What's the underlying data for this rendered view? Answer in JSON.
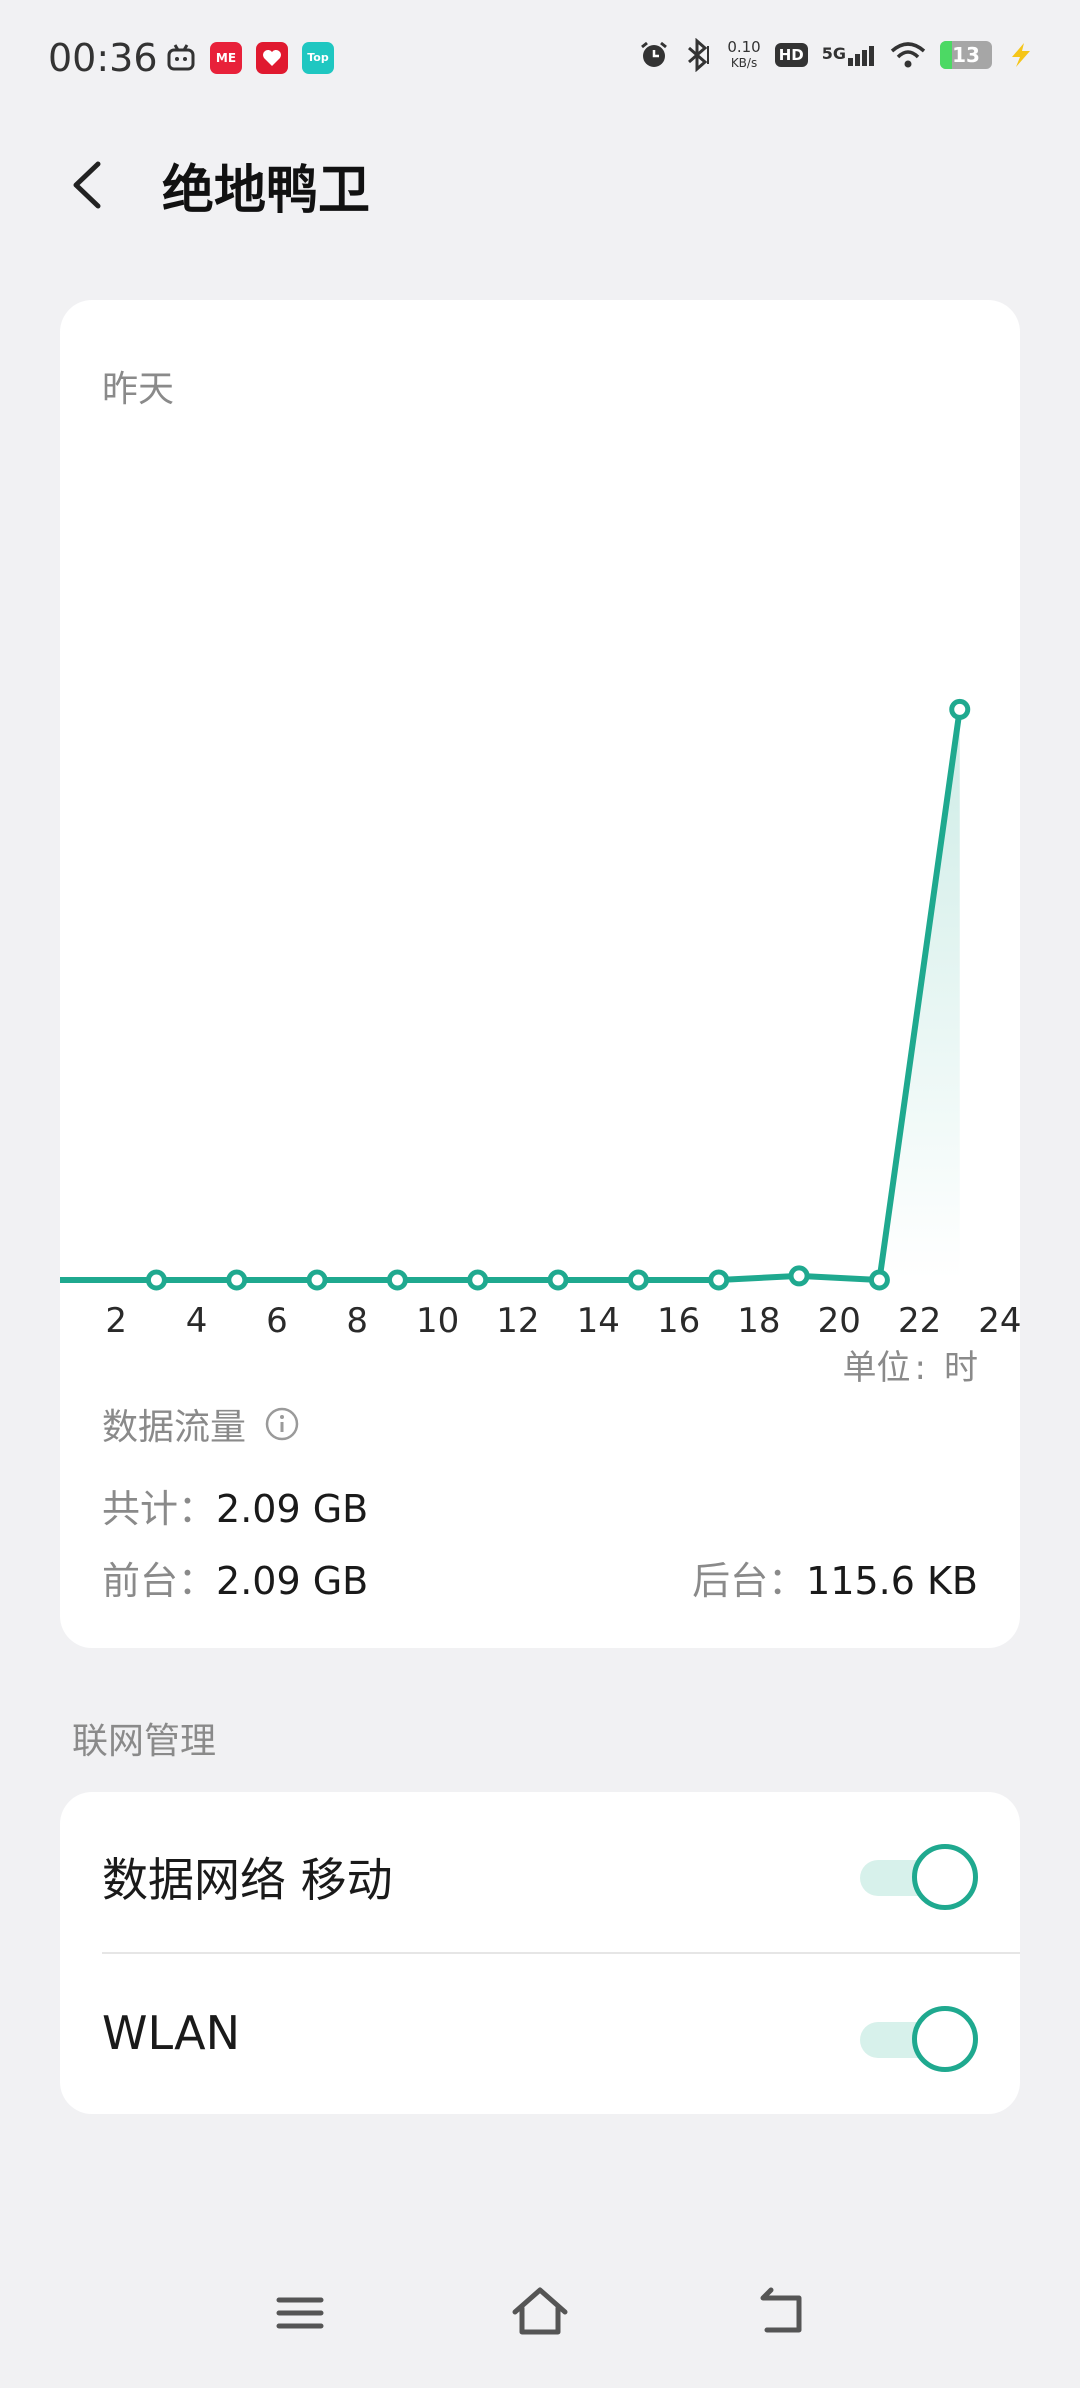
{
  "status": {
    "time": "00:36",
    "net_speed_value": "0.10",
    "net_speed_unit": "KB/s",
    "hd_label": "HD",
    "network_type": "5G",
    "battery": "13",
    "app_badges": [
      {
        "label": "ME",
        "color": "#e8213a"
      },
      {
        "label": "",
        "color": "#e0192f"
      },
      {
        "label": "Top",
        "color": "#1fc7c1"
      }
    ]
  },
  "header": {
    "title": "绝地鸭卫"
  },
  "usage_card": {
    "period_label": "昨天",
    "unit_label": "单位",
    "unit_sep": ":",
    "unit_value": "时",
    "data_flow_label": "数据流量",
    "total_label": "共计：",
    "total_value": "2.09 GB",
    "foreground_label": "前台：",
    "foreground_value": "2.09 GB",
    "background_label": "后台：",
    "background_value": "115.6 KB"
  },
  "chart_data": {
    "type": "line",
    "x_tick_labels": [
      "2",
      "4",
      "6",
      "8",
      "10",
      "12",
      "14",
      "16",
      "18",
      "20",
      "22",
      "24"
    ],
    "x": [
      3,
      5,
      7,
      9,
      11,
      13,
      15,
      17,
      19,
      21,
      23
    ],
    "values": [
      0,
      0,
      0,
      0,
      0,
      0,
      0,
      0,
      0.015,
      0,
      2.09
    ],
    "xlim": [
      0.6,
      24.5
    ],
    "ylim": [
      0,
      3.15
    ],
    "color": "#1fa98f"
  },
  "network_section": {
    "title": "联网管理",
    "rows": [
      {
        "label": "数据网络 移动",
        "enabled": true
      },
      {
        "label": "WLAN",
        "enabled": true
      }
    ]
  },
  "colors": {
    "accent": "#1fa98f",
    "accent_light": "#d7f1eb",
    "background": "#f1f1f3"
  }
}
